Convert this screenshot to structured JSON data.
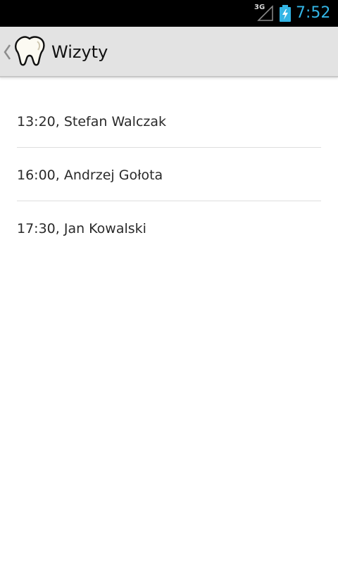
{
  "status_bar": {
    "network_label": "3G",
    "clock": "7:52",
    "clock_color": "#33b5e5",
    "icons": [
      "signal-icon",
      "battery-charging-icon"
    ]
  },
  "action_bar": {
    "title": "Wizyty",
    "icons": [
      "back-caret-icon",
      "tooth-icon"
    ]
  },
  "visits": [
    "13:20, Stefan Walczak",
    "16:00, Andrzej Gołota",
    "17:30, Jan Kowalski"
  ]
}
